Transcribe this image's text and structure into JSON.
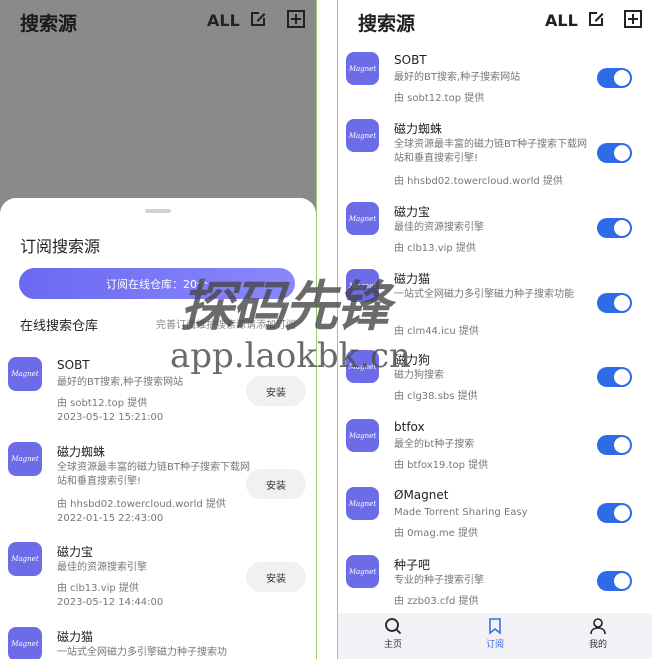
{
  "left": {
    "header": {
      "title": "搜索源",
      "all_label": "ALL"
    },
    "sheet": {
      "title": "订阅搜索源",
      "subscribe_label": "订阅在线仓库：20个",
      "online_label": "在线搜索仓库",
      "online_hint": "完善订阅维护搜索源请添加订阅"
    },
    "repos": [
      {
        "name": "SOBT",
        "desc": "最好的BT搜索,种子搜索网站",
        "by": "由 sobt12.top 提供",
        "date": "2023-05-12 15:21:00",
        "action": "安装",
        "icon_text": "Magnet"
      },
      {
        "name": "磁力蜘蛛",
        "desc": "全球资源最丰富的磁力链BT种子搜索下载网站和垂直搜索引擎!",
        "by": "由 hhsbd02.towercloud.world 提供",
        "date": "2022-01-15 22:43:00",
        "action": "安装",
        "icon_text": "Magnet"
      },
      {
        "name": "磁力宝",
        "desc": "最佳的资源搜索引擎",
        "by": "由 clb13.vip 提供",
        "date": "2023-05-12 14:44:00",
        "action": "安装",
        "icon_text": "Magnet"
      },
      {
        "name": "磁力猫",
        "desc": "一站式全网磁力多引擎磁力种子搜索功",
        "by": "",
        "date": "",
        "action": "",
        "icon_text": "Magnet"
      }
    ]
  },
  "right": {
    "header": {
      "title": "搜索源",
      "all_label": "ALL"
    },
    "sources": [
      {
        "name": "SOBT",
        "desc": "最好的BT搜索,种子搜索网站",
        "by": "由 sobt12.top 提供",
        "enabled": true,
        "icon_text": "Magnet"
      },
      {
        "name": "磁力蜘蛛",
        "desc": "全球资源最丰富的磁力链BT种子搜索下载网站和垂直搜索引擎!",
        "by": "由 hhsbd02.towercloud.world 提供",
        "enabled": true,
        "icon_text": "Magnet"
      },
      {
        "name": "磁力宝",
        "desc": "最佳的资源搜索引擎",
        "by": "由 clb13.vip 提供",
        "enabled": true,
        "icon_text": "Magnet"
      },
      {
        "name": "磁力猫",
        "desc": "一站式全网磁力多引擎磁力种子搜索功能",
        "by": "由 clm44.icu 提供",
        "enabled": true,
        "icon_text": "Magnet"
      },
      {
        "name": "磁力狗",
        "desc": "磁力狗搜索",
        "by": "由 clg38.sbs 提供",
        "enabled": true,
        "icon_text": "Magnet"
      },
      {
        "name": "btfox",
        "desc": "最全的bt种子搜索",
        "by": "由 btfox19.top 提供",
        "enabled": true,
        "icon_text": "Magnet"
      },
      {
        "name": "ØMagnet",
        "desc": "Made Torrent Sharing  Easy",
        "by": "由 0mag.me 提供",
        "enabled": true,
        "icon_text": "Magnet"
      },
      {
        "name": "种子吧",
        "desc": "专业的种子搜索引擎",
        "by": "由 zzb03.cfd 提供",
        "enabled": true,
        "icon_text": "Magnet"
      }
    ],
    "nav": [
      {
        "label": "主页",
        "icon": "search-icon"
      },
      {
        "label": "订阅",
        "icon": "bookmark-icon"
      },
      {
        "label": "我的",
        "icon": "person-icon"
      }
    ],
    "nav_active": "订阅",
    "accent": "#2e6be6"
  },
  "watermark": {
    "text_cn": "探码先锋",
    "text_url": "app.laokbk.cn"
  }
}
